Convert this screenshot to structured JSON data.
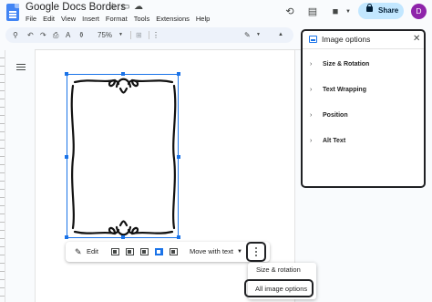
{
  "app": {
    "doc_title": "Google Docs Borders",
    "menus": [
      "File",
      "Edit",
      "View",
      "Insert",
      "Format",
      "Tools",
      "Extensions",
      "Help"
    ],
    "share_label": "Share",
    "avatar_initial": "D"
  },
  "toolbar": {
    "zoom": "75%"
  },
  "image_bar": {
    "edit_label": "Edit",
    "position_label": "Move with text"
  },
  "image_menu": {
    "item1": "Size & rotation",
    "item2": "All image options"
  },
  "panel": {
    "title": "Image options",
    "sections": [
      "Size & Rotation",
      "Text Wrapping",
      "Position",
      "Alt Text"
    ]
  },
  "colors": {
    "accent": "#1a73e8",
    "share_bg": "#c2e7ff",
    "highlight_border": "#202124"
  }
}
